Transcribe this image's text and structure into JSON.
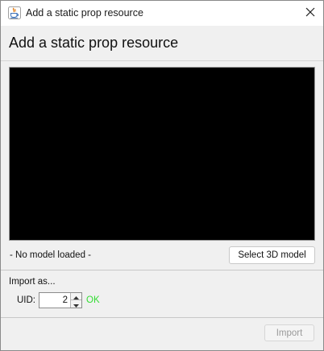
{
  "window": {
    "title": "Add a static prop resource",
    "close_icon": "close-icon",
    "app_icon": "java-cup-icon"
  },
  "header": {
    "title": "Add a static prop resource"
  },
  "preview": {
    "background": "#000000",
    "status_text": "- No model loaded -",
    "select_button_label": "Select 3D model"
  },
  "import_section": {
    "label": "Import as...",
    "uid_label": "UID:",
    "uid_value": "2",
    "uid_status": "OK",
    "uid_status_color": "#33dd33"
  },
  "footer": {
    "import_button_label": "Import",
    "import_button_enabled": false
  }
}
